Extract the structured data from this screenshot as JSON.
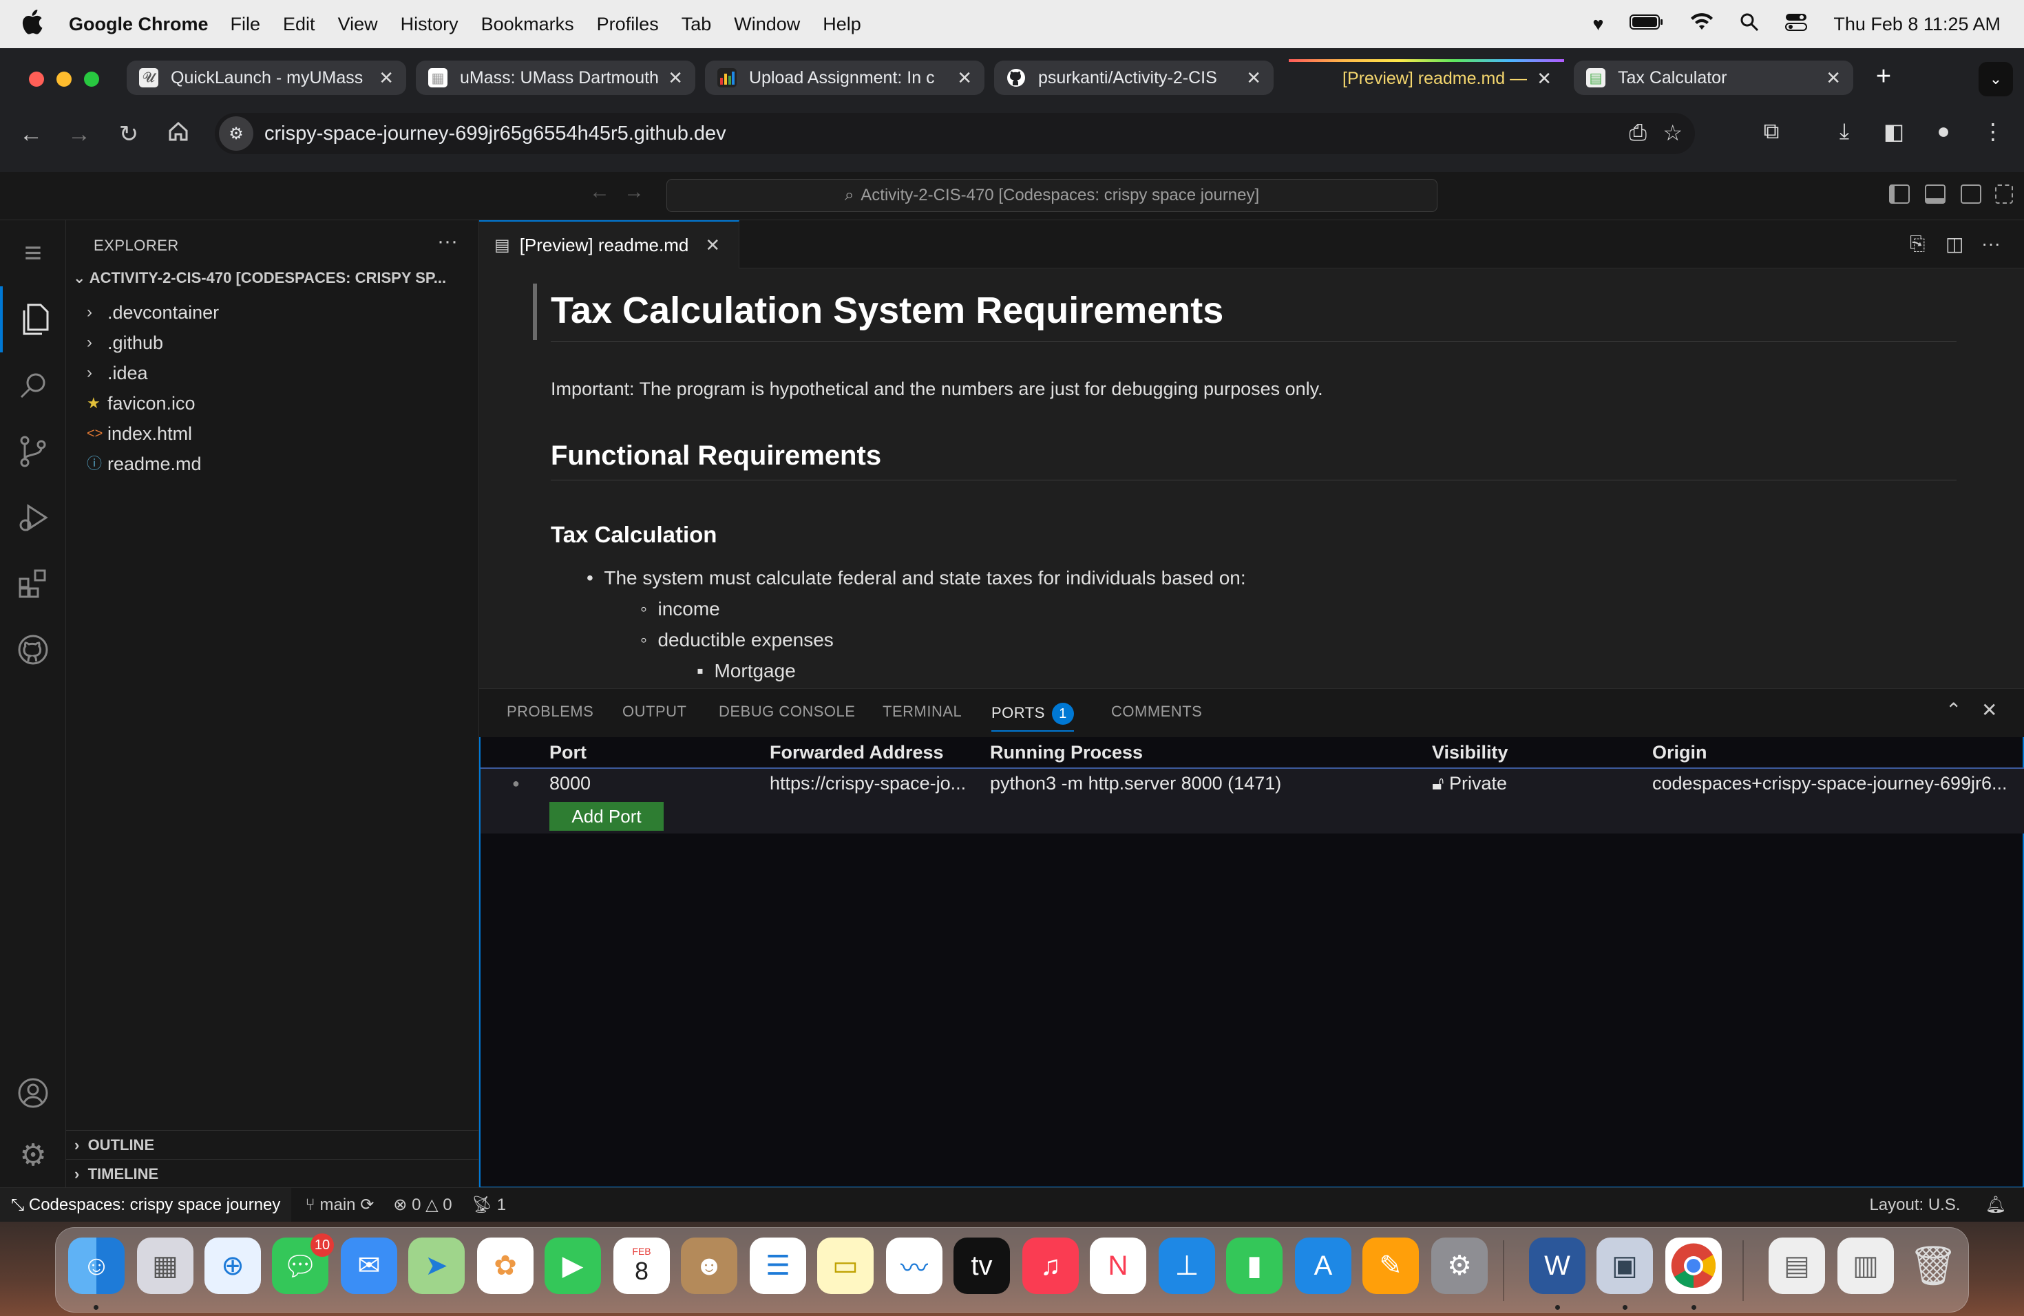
{
  "menubar": {
    "app_name": "Google Chrome",
    "items": [
      "File",
      "Edit",
      "View",
      "History",
      "Bookmarks",
      "Profiles",
      "Tab",
      "Window",
      "Help"
    ],
    "clock": "Thu Feb 8  11:25 AM"
  },
  "chrome": {
    "tabs": [
      {
        "title": "QuickLaunch - myUMass",
        "state": "inactive"
      },
      {
        "title": "uMass: UMass Dartmouth",
        "state": "inactive"
      },
      {
        "title": "Upload Assignment: In c",
        "state": "inactive"
      },
      {
        "title": "psurkanti/Activity-2-CIS",
        "state": "inactive"
      },
      {
        "title": "[Preview] readme.md —",
        "state": "active"
      },
      {
        "title": "Tax Calculator",
        "state": "inactive"
      }
    ],
    "url": "crispy-space-journey-699jr65g6554h45r5.github.dev"
  },
  "vscode": {
    "command_center": "Activity-2-CIS-470 [Codespaces: crispy space journey]",
    "explorer": {
      "title": "EXPLORER",
      "folder": "ACTIVITY-2-CIS-470 [CODESPACES: CRISPY SP...",
      "items": [
        {
          "name": ".devcontainer",
          "kind": "folder",
          "icon": "chevron-right-icon"
        },
        {
          "name": ".github",
          "kind": "folder",
          "icon": "chevron-right-icon"
        },
        {
          "name": ".idea",
          "kind": "folder",
          "icon": "chevron-right-icon"
        },
        {
          "name": "favicon.ico",
          "kind": "file",
          "icon": "star-icon"
        },
        {
          "name": "index.html",
          "kind": "file",
          "icon": "html-icon"
        },
        {
          "name": "readme.md",
          "kind": "file",
          "icon": "info-icon"
        }
      ],
      "outline": "OUTLINE",
      "timeline": "TIMELINE"
    },
    "editor_tab": "[Preview] readme.md",
    "preview": {
      "h1": "Tax Calculation System Requirements",
      "note": "Important: The program is hypothetical and the numbers are just for debugging purposes only.",
      "h2": "Functional Requirements",
      "h3": "Tax Calculation",
      "bullet1": "The system must calculate federal and state taxes for individuals based on:",
      "sub1": "income",
      "sub2": "deductible expenses",
      "subsub1": "Mortgage"
    },
    "panel": {
      "tabs": [
        "PROBLEMS",
        "OUTPUT",
        "DEBUG CONSOLE",
        "TERMINAL",
        "PORTS",
        "COMMENTS"
      ],
      "ports_badge": "1",
      "columns": [
        "Port",
        "Forwarded Address",
        "Running Process",
        "Visibility",
        "Origin"
      ],
      "row": {
        "port": "8000",
        "address": "https://crispy-space-jo...",
        "process": "python3 -m http.server 8000 (1471)",
        "visibility": "Private",
        "origin": "codespaces+crispy-space-journey-699jr6..."
      },
      "add_port": "Add Port"
    },
    "statusbar": {
      "remote": "Codespaces: crispy space journey",
      "branch": "main",
      "errors": "0",
      "warnings": "0",
      "ports": "1",
      "layout": "Layout: U.S."
    }
  },
  "dock": {
    "messages_badge": "10",
    "calendar_month": "FEB",
    "calendar_day": "8"
  }
}
